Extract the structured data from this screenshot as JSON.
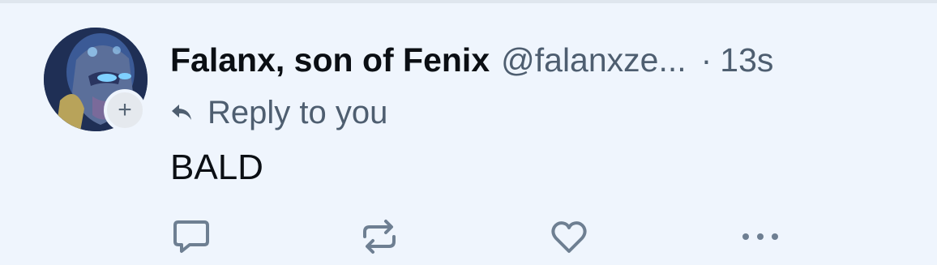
{
  "post": {
    "author": {
      "display_name": "Falanx, son of Fenix",
      "handle": "@falanxze...",
      "avatar_icon": "protoss-warrior-avatar"
    },
    "separator": "·",
    "timestamp": "13s",
    "reply_context": "Reply to you",
    "text": "BALD"
  },
  "follow_badge": {
    "symbol": "+",
    "icon": "plus-icon"
  },
  "actions": [
    {
      "name": "reply",
      "icon": "comment-bubble-icon"
    },
    {
      "name": "repost",
      "icon": "repost-icon"
    },
    {
      "name": "like",
      "icon": "heart-icon"
    },
    {
      "name": "more",
      "icon": "ellipsis-icon"
    }
  ],
  "colors": {
    "background": "#eff5fd",
    "text_primary": "#0b0f14",
    "text_secondary": "#4e5e70",
    "icon": "#6e7f92"
  }
}
